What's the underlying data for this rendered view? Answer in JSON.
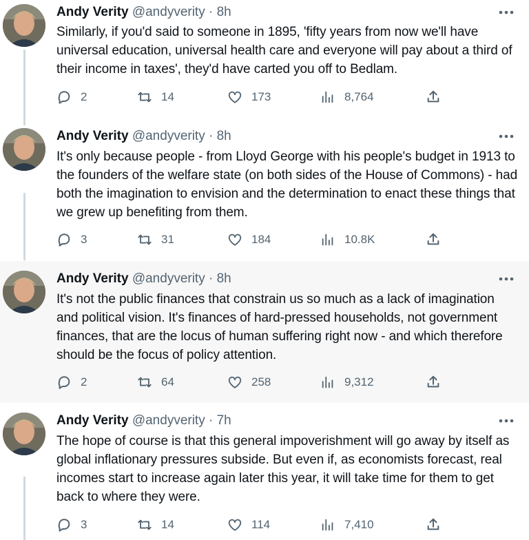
{
  "tweets": [
    {
      "name": "Andy Verity",
      "handle": "@andyverity",
      "time": "8h",
      "text": "Similarly, if you'd said to someone in 1895, 'fifty years from now we'll have universal education, universal health care and everyone will pay about a third of their income in taxes', they'd have carted you off to Bedlam.",
      "replies": "2",
      "retweets": "14",
      "likes": "173",
      "views": "8,764"
    },
    {
      "name": "Andy Verity",
      "handle": "@andyverity",
      "time": "8h",
      "text": "It's only because people - from Lloyd George with his people's budget in 1913 to the founders of the welfare state (on both sides of the House of Commons) - had both the imagination to envision and the determination to enact these things that we grew up benefiting from them.",
      "replies": "3",
      "retweets": "31",
      "likes": "184",
      "views": "10.8K"
    },
    {
      "name": "Andy Verity",
      "handle": "@andyverity",
      "time": "8h",
      "text": "It's not the public finances that constrain us so much as a lack of imagination and political vision. It's finances of hard-pressed households, not government finances, that are the locus of human suffering right now - and which therefore should be the focus of policy attention.",
      "replies": "2",
      "retweets": "64",
      "likes": "258",
      "views": "9,312"
    },
    {
      "name": "Andy Verity",
      "handle": "@andyverity",
      "time": "7h",
      "text": "The hope of course is that this general impoverishment will go away by itself as global inflationary pressures subside. But even if, as economists forecast, real incomes start to increase again later this year, it will take time for them to get back to where they were.",
      "replies": "3",
      "retweets": "14",
      "likes": "114",
      "views": "7,410"
    }
  ],
  "colors": {
    "text": "#0f1419",
    "secondary": "#536471",
    "thread_line": "#cfd9de",
    "highlight_bg": "#f7f7f7"
  },
  "icons": [
    "reply-icon",
    "retweet-icon",
    "like-icon",
    "views-icon",
    "share-icon",
    "more-icon"
  ]
}
